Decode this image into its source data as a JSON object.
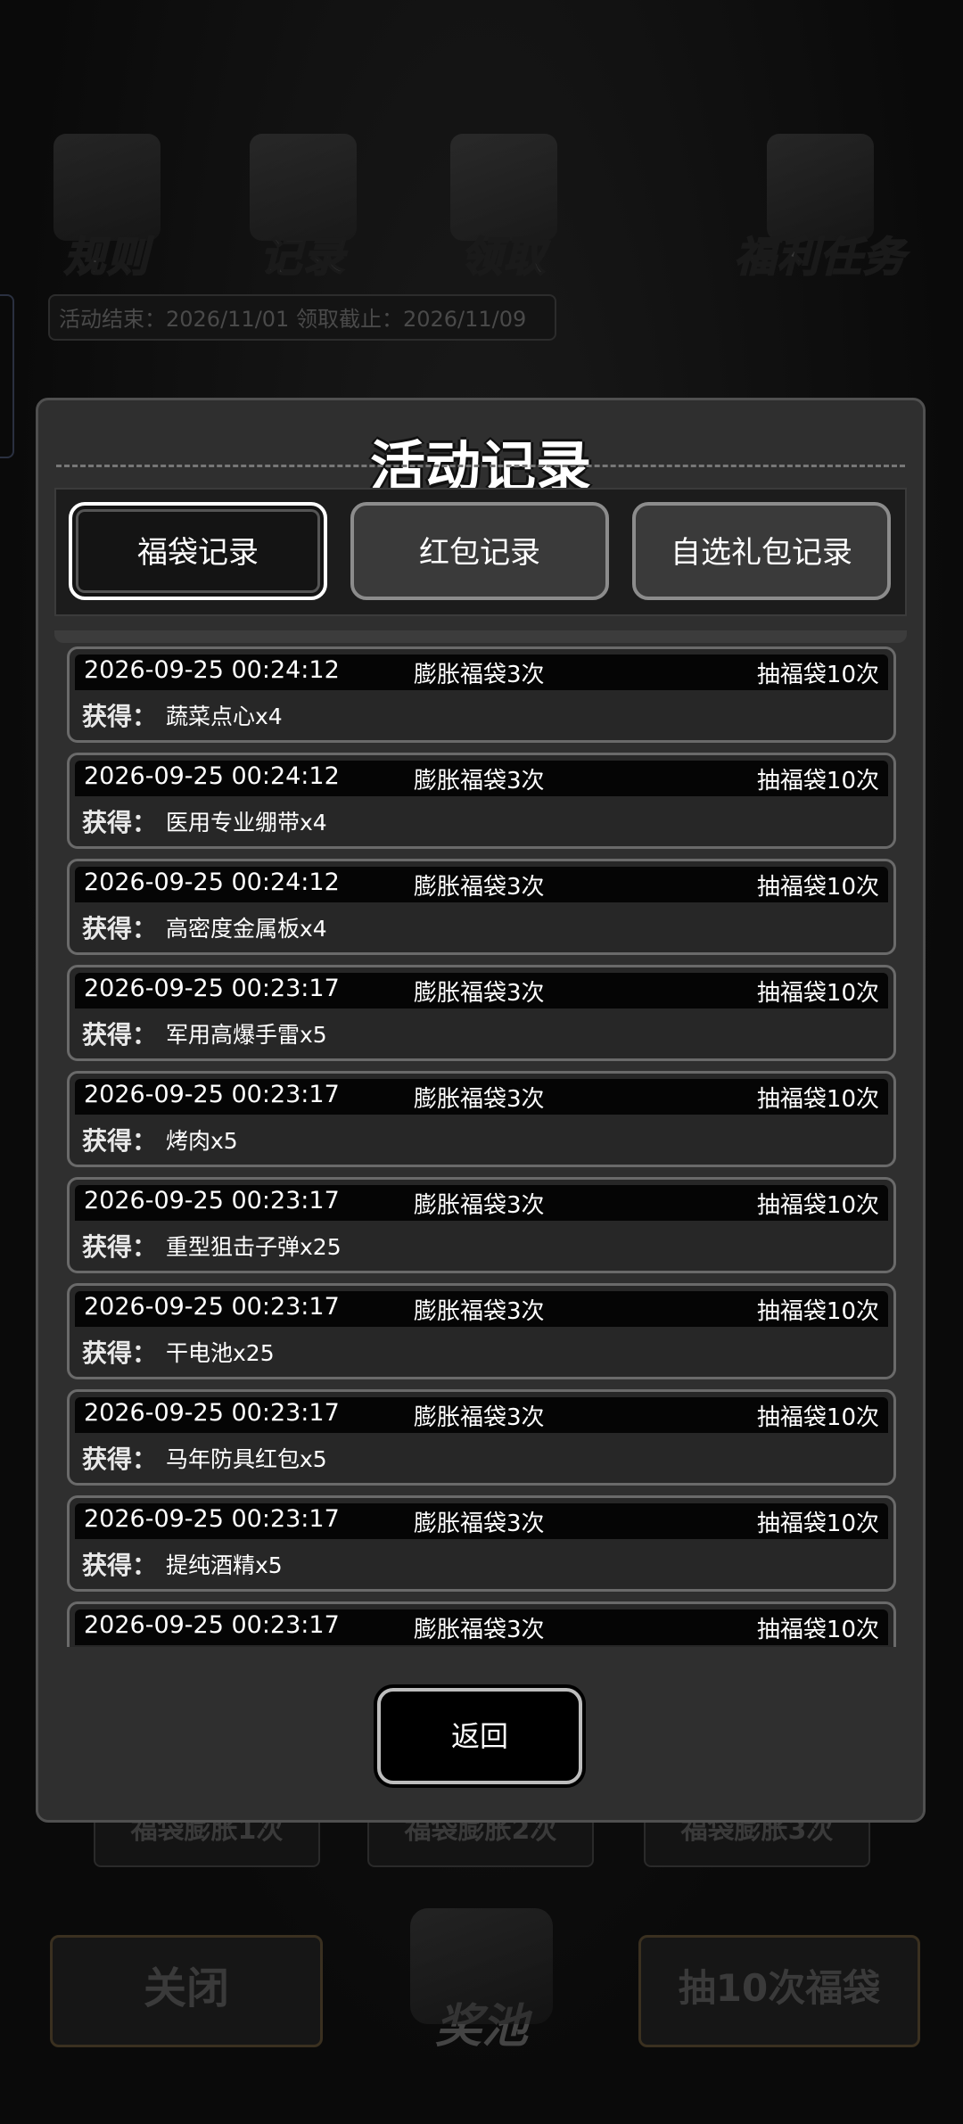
{
  "background": {
    "top_icons": [
      {
        "label": "规则",
        "icon": "rulebook-icon"
      },
      {
        "label": "记录",
        "icon": "record-icon"
      },
      {
        "label": "领取",
        "icon": "claim-icon"
      },
      {
        "label": "福利任务",
        "icon": "welfare-task-icon"
      }
    ],
    "dates_text": "活动结束：2026/11/01  领取截止：2026/11/09",
    "under_buttons": [
      "福袋膨胀1次",
      "福袋膨胀2次",
      "福袋膨胀3次"
    ],
    "close_label": "关闭",
    "prize_pool_label": "奖池",
    "draw10_label": "抽10次福袋"
  },
  "modal": {
    "title": "活动记录",
    "tabs": [
      {
        "label": "福袋记录",
        "active": true
      },
      {
        "label": "红包记录",
        "active": false
      },
      {
        "label": "自选礼包记录",
        "active": false
      }
    ],
    "obtained_label": "获得：",
    "records": [
      {
        "time": "2026-09-25 00:24:12",
        "kind": "膨胀福袋3次",
        "draw": "抽福袋10次",
        "item": "蔬菜点心x4"
      },
      {
        "time": "2026-09-25 00:24:12",
        "kind": "膨胀福袋3次",
        "draw": "抽福袋10次",
        "item": "医用专业绷带x4"
      },
      {
        "time": "2026-09-25 00:24:12",
        "kind": "膨胀福袋3次",
        "draw": "抽福袋10次",
        "item": "高密度金属板x4"
      },
      {
        "time": "2026-09-25 00:23:17",
        "kind": "膨胀福袋3次",
        "draw": "抽福袋10次",
        "item": "军用高爆手雷x5"
      },
      {
        "time": "2026-09-25 00:23:17",
        "kind": "膨胀福袋3次",
        "draw": "抽福袋10次",
        "item": "烤肉x5"
      },
      {
        "time": "2026-09-25 00:23:17",
        "kind": "膨胀福袋3次",
        "draw": "抽福袋10次",
        "item": "重型狙击子弹x25"
      },
      {
        "time": "2026-09-25 00:23:17",
        "kind": "膨胀福袋3次",
        "draw": "抽福袋10次",
        "item": "干电池x25"
      },
      {
        "time": "2026-09-25 00:23:17",
        "kind": "膨胀福袋3次",
        "draw": "抽福袋10次",
        "item": "马年防具红包x5"
      },
      {
        "time": "2026-09-25 00:23:17",
        "kind": "膨胀福袋3次",
        "draw": "抽福袋10次",
        "item": "提纯酒精x5"
      },
      {
        "time": "2026-09-25 00:23:17",
        "kind": "膨胀福袋3次",
        "draw": "抽福袋10次",
        "item": ""
      }
    ],
    "back_label": "返回"
  }
}
